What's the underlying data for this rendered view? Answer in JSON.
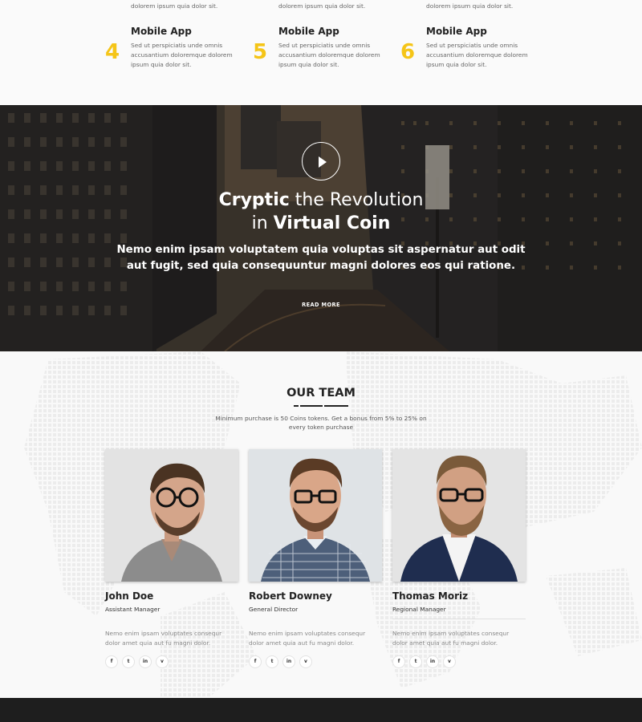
{
  "services": {
    "top_row_desc": "dolorem ipsum quia dolor sit.",
    "items": [
      {
        "num": "4",
        "title": "Mobile App",
        "desc": "Sed ut perspiciatis unde omnis accusantium doloremque dolorem ipsum quia dolor sit."
      },
      {
        "num": "5",
        "title": "Mobile App",
        "desc": "Sed ut perspiciatis unde omnis accusantium doloremque dolorem ipsum quia dolor sit."
      },
      {
        "num": "6",
        "title": "Mobile App",
        "desc": "Sed ut perspiciatis unde omnis accusantium doloremque dolorem ipsum quia dolor sit."
      }
    ],
    "accent": "#f5c518"
  },
  "hero": {
    "title_bold_1": "Cryptic",
    "title_rest_1": " the Revolution",
    "title_pre_2": "in ",
    "title_bold_2": "Virtual Coin",
    "lead": "Nemo enim ipsam voluptatem quia voluptas sit aspernatur aut odit aut fugit, sed quia consequuntur magni dolores eos qui ratione.",
    "cta": "READ MORE",
    "play_icon": "play-icon"
  },
  "team": {
    "heading": "OUR TEAM",
    "intro": "Minimum purchase is 50 Coins tokens. Get a bonus from 5% to 25% on every token purchase",
    "members": [
      {
        "name": "John Doe",
        "role": "Assistant Manager",
        "bio": "Nemo enim ipsam voluptates consequr dolor amet quia aut fu magni dolor."
      },
      {
        "name": "Robert Downey",
        "role": "General Director",
        "bio": "Nemo enim ipsam voluptates consequr dolor amet quia aut fu magni dolor."
      },
      {
        "name": "Thomas Moriz",
        "role": "Regional Manager",
        "bio": "Nemo enim ipsam voluptates consequr dolor amet quia aut fu magni dolor."
      }
    ],
    "social": {
      "facebook": "f",
      "twitter": "t",
      "linkedin": "in",
      "vimeo": "v"
    }
  }
}
